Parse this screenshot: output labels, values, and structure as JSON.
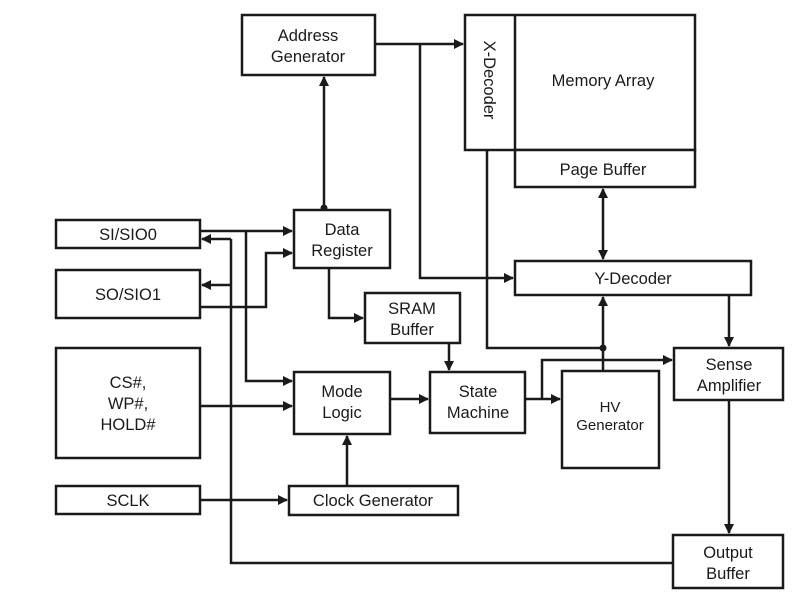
{
  "diagram": {
    "blocks": {
      "address_generator": [
        "Address",
        "Generator"
      ],
      "x_decoder": "X-Decoder",
      "memory_array": "Memory Array",
      "page_buffer": "Page Buffer",
      "si_sio0": "SI/SIO0",
      "so_sio1": "SO/SIO1",
      "data_register": [
        "Data",
        "Register"
      ],
      "sram_buffer": [
        "SRAM",
        "Buffer"
      ],
      "y_decoder": "Y-Decoder",
      "control_pins": [
        "CS#,",
        "WP#,",
        "HOLD#"
      ],
      "mode_logic": [
        "Mode",
        "Logic"
      ],
      "state_machine": [
        "State",
        "Machine"
      ],
      "hv_generator": [
        "HV",
        "Generator"
      ],
      "sense_amplifier": [
        "Sense",
        "Amplifier"
      ],
      "sclk": "SCLK",
      "clock_generator": "Clock Generator",
      "output_buffer": [
        "Output",
        "Buffer"
      ]
    }
  }
}
